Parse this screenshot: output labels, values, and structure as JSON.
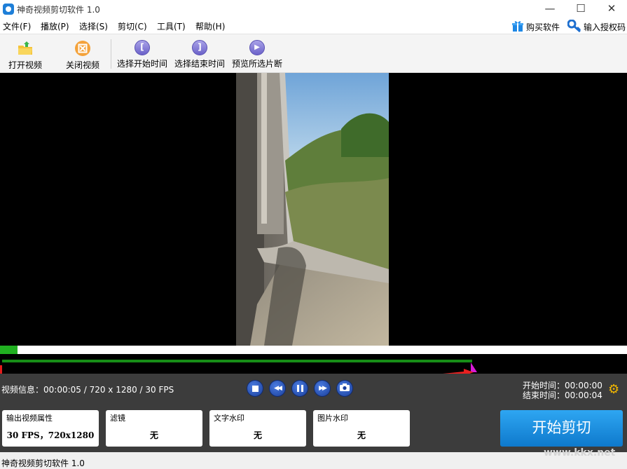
{
  "window": {
    "title": "神奇视频剪切软件 1.0",
    "minimize": "—",
    "maximize": "☐",
    "close": "✕"
  },
  "menu": {
    "items": [
      "文件(F)",
      "播放(P)",
      "选择(S)",
      "剪切(C)",
      "工具(T)",
      "帮助(H)"
    ],
    "buy": "购买软件",
    "license": "输入授权码"
  },
  "toolbar": {
    "open_video": "打开视频",
    "close_video": "关闭视频",
    "select_start": "选择开始时间",
    "select_end": "选择结束时间",
    "preview": "预览所选片断"
  },
  "timeline": {
    "progress_fraction": 0.028,
    "selection_fraction": 0.75
  },
  "info": {
    "video_info": "视频信息：00:00:05 / 720 x 1280 / 30 FPS",
    "start_time": "开始时间：00:00:00",
    "end_time": "结束时间：00:00:04"
  },
  "panels": {
    "output": {
      "title": "输出视频属性",
      "value": "30 FPS，720x1280"
    },
    "filter": {
      "title": "滤镜",
      "value": "无"
    },
    "text_watermark": {
      "title": "文字水印",
      "value": "无"
    },
    "image_watermark": {
      "title": "图片水印",
      "value": "无"
    }
  },
  "start_button": "开始剪切",
  "status": "神奇视频剪切软件 1.0",
  "watermark": "www.kkx.net",
  "colors": {
    "accent_button": "#1a8fe0",
    "timeline_fill": "#21b021",
    "control_bg": "#3c3c3c"
  }
}
